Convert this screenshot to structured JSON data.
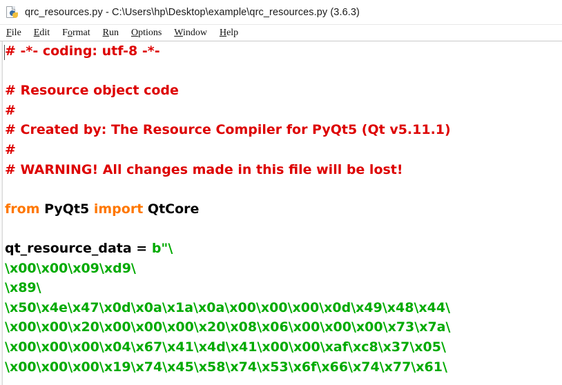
{
  "window": {
    "title": "qrc_resources.py - C:\\Users\\hp\\Desktop\\example\\qrc_resources.py (3.6.3)",
    "icon": "python-file-icon"
  },
  "menubar": {
    "items": [
      {
        "label": "File",
        "accel": "F",
        "rest": "ile"
      },
      {
        "label": "Edit",
        "accel": "E",
        "rest": "dit"
      },
      {
        "label": "Format",
        "pre": "F",
        "accel": "o",
        "rest": "rmat"
      },
      {
        "label": "Run",
        "accel": "R",
        "rest": "un"
      },
      {
        "label": "Options",
        "accel": "O",
        "rest": "ptions"
      },
      {
        "label": "Window",
        "accel": "W",
        "rest": "indow"
      },
      {
        "label": "Help",
        "accel": "H",
        "rest": "elp"
      }
    ]
  },
  "colors": {
    "comment": "#dd0000",
    "keyword": "#ff7700",
    "string": "#00aa00",
    "identifier": "#000000",
    "background": "#ffffff"
  },
  "editor": {
    "lines": [
      {
        "n": 1,
        "tokens": [
          {
            "t": "comment",
            "v": "# -*- coding: utf-8 -*-"
          }
        ]
      },
      {
        "n": 2,
        "tokens": [
          {
            "t": "plain",
            "v": ""
          }
        ]
      },
      {
        "n": 3,
        "tokens": [
          {
            "t": "comment",
            "v": "# Resource object code"
          }
        ]
      },
      {
        "n": 4,
        "tokens": [
          {
            "t": "comment",
            "v": "#"
          }
        ]
      },
      {
        "n": 5,
        "tokens": [
          {
            "t": "comment",
            "v": "# Created by: The Resource Compiler for PyQt5 (Qt v5.11.1)"
          }
        ]
      },
      {
        "n": 6,
        "tokens": [
          {
            "t": "comment",
            "v": "#"
          }
        ]
      },
      {
        "n": 7,
        "tokens": [
          {
            "t": "comment",
            "v": "# WARNING! All changes made in this file will be lost!"
          }
        ]
      },
      {
        "n": 8,
        "tokens": [
          {
            "t": "plain",
            "v": ""
          }
        ]
      },
      {
        "n": 9,
        "tokens": [
          {
            "t": "keyword",
            "v": "from"
          },
          {
            "t": "plain",
            "v": " "
          },
          {
            "t": "identifier",
            "v": "PyQt5"
          },
          {
            "t": "plain",
            "v": " "
          },
          {
            "t": "keyword",
            "v": "import"
          },
          {
            "t": "plain",
            "v": " "
          },
          {
            "t": "identifier",
            "v": "QtCore"
          }
        ]
      },
      {
        "n": 10,
        "tokens": [
          {
            "t": "plain",
            "v": ""
          }
        ]
      },
      {
        "n": 11,
        "tokens": [
          {
            "t": "identifier",
            "v": "qt_resource_data = "
          },
          {
            "t": "string",
            "v": "b\"\\"
          }
        ]
      },
      {
        "n": 12,
        "tokens": [
          {
            "t": "string",
            "v": "\\x00\\x00\\x09\\xd9\\"
          }
        ]
      },
      {
        "n": 13,
        "tokens": [
          {
            "t": "string",
            "v": "\\x89\\"
          }
        ]
      },
      {
        "n": 14,
        "tokens": [
          {
            "t": "string",
            "v": "\\x50\\x4e\\x47\\x0d\\x0a\\x1a\\x0a\\x00\\x00\\x00\\x0d\\x49\\x48\\x44\\"
          }
        ]
      },
      {
        "n": 15,
        "tokens": [
          {
            "t": "string",
            "v": "\\x00\\x00\\x20\\x00\\x00\\x00\\x20\\x08\\x06\\x00\\x00\\x00\\x73\\x7a\\"
          }
        ]
      },
      {
        "n": 16,
        "tokens": [
          {
            "t": "string",
            "v": "\\x00\\x00\\x00\\x04\\x67\\x41\\x4d\\x41\\x00\\x00\\xaf\\xc8\\x37\\x05\\"
          }
        ]
      },
      {
        "n": 17,
        "tokens": [
          {
            "t": "string",
            "v": "\\x00\\x00\\x00\\x19\\x74\\x45\\x58\\x74\\x53\\x6f\\x66\\x74\\x77\\x61\\"
          }
        ]
      }
    ]
  }
}
